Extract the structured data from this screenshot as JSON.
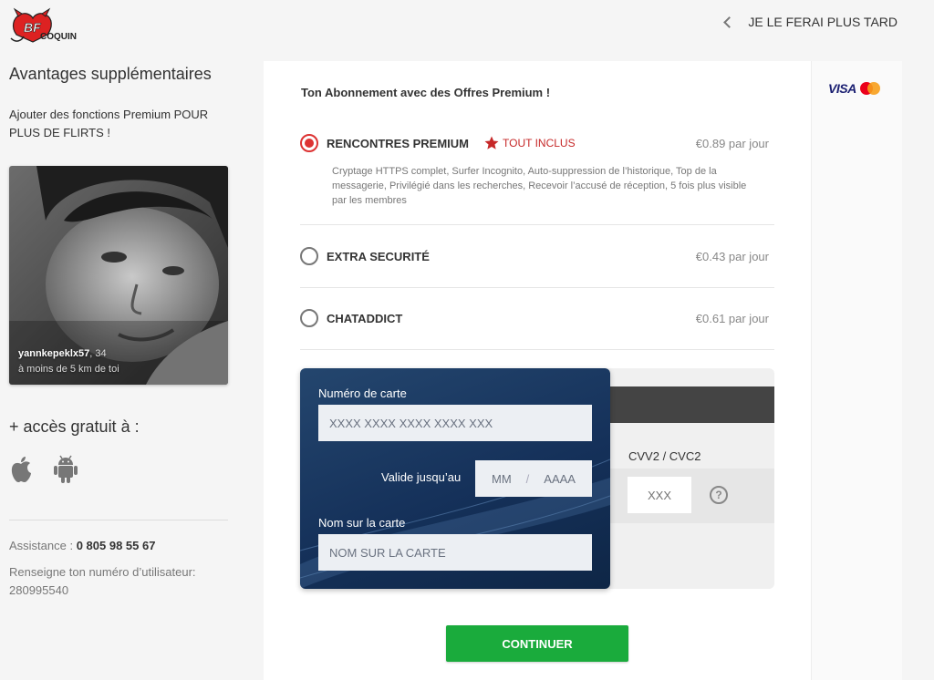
{
  "header": {
    "logo_text": "BF COQUIN",
    "later_label": "JE LE FERAI PLUS TARD"
  },
  "sidebar": {
    "title": "Avantages supplémentaires",
    "subtitle": "Ajouter des fonctions Premium POUR PLUS DE FLIRTS !",
    "profile": {
      "username": "yannkepeklx57",
      "age": ", 34",
      "distance": "à moins de 5 km de toi"
    },
    "free_access_title": "+ accès gratuit à :",
    "platform_icons": [
      "apple-icon",
      "android-icon"
    ],
    "assistance_label": "Assistance : ",
    "assistance_phone": "0 805 98 55 67",
    "user_number_label": "Renseigne ton numéro d’utilisateur:",
    "user_number": "280995540"
  },
  "payment_brands": {
    "visa": "VISA",
    "mastercard_icon": "mastercard-icon"
  },
  "main": {
    "title": "Ton Abonnement avec des Offres Premium !",
    "offers": [
      {
        "name": "RENCONTRES PREMIUM",
        "badge": "TOUT INCLUS",
        "price": "€0.89 par jour",
        "selected": true,
        "description": "Cryptage HTTPS complet, Surfer Incognito, Auto-suppression de l’historique, Top de la messagerie, Privilégié dans les recherches, Recevoir l’accusé de réception, 5 fois plus visible par les membres"
      },
      {
        "name": "EXTRA SECURITÉ",
        "price": "€0.43 par jour",
        "selected": false
      },
      {
        "name": "CHATADDICT",
        "price": "€0.61 par jour",
        "selected": false
      }
    ],
    "card": {
      "number_label": "Numéro de carte",
      "number_placeholder": "XXXX XXXX XXXX XXXX XXX",
      "expiry_label": "Valide jusqu’au",
      "expiry_month_placeholder": "MM",
      "expiry_sep": "/",
      "expiry_year_placeholder": "AAAA",
      "name_label": "Nom sur la carte",
      "name_placeholder": "NOM SUR LA CARTE",
      "cvv_label": "CVV2 / CVC2",
      "cvv_placeholder": "XXX",
      "help_symbol": "?"
    },
    "continue_label": "CONTINUER"
  },
  "colors": {
    "accent_red": "#d33333",
    "continue_green": "#1aab3c",
    "card_blue": "#15315a"
  }
}
